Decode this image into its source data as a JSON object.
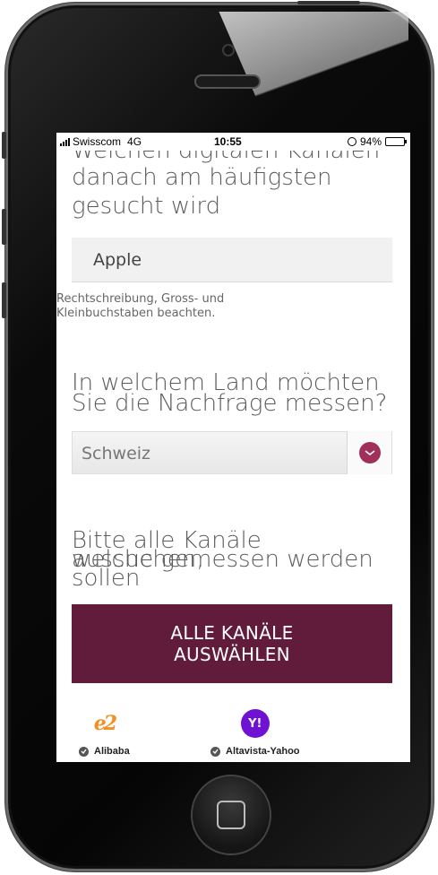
{
  "status_bar": {
    "carrier": "Swisscom",
    "network": "4G",
    "time": "10:55",
    "battery": "94%",
    "battery_level": 0.94
  },
  "form": {
    "scrolled_heading_partial": "Welchen digitalen Kanälen",
    "keyword_heading_line1": "danach am häufigsten",
    "keyword_heading_line2": "gesucht wird",
    "keyword_input_value": "Apple",
    "keyword_hint_line1": "Rechtschreibung, Gross- und",
    "keyword_hint_line2": "Kleinbuchstaben beachten.",
    "country_heading_line1": "In welchem Land möchten",
    "country_heading_line2": "Sie die Nachfrage messen?",
    "country_selected": "Schweiz",
    "channels_heading_line1": "Bitte alle Kanäle aussuchen,",
    "channels_heading_line2": "welche gemessen werden",
    "channels_heading_line3": "sollen",
    "select_all_line1": "ALLE KANÄLE",
    "select_all_line2": "AUSWÄHLEN"
  },
  "channels": [
    {
      "name": "Alibaba",
      "logo_text": "e2",
      "checked": true
    },
    {
      "name": "Altavista-Yahoo",
      "logo_text": "Y!",
      "checked": true
    }
  ],
  "colors": {
    "accent": "#611c3c",
    "dropdown_icon": "#a0305a",
    "alibaba": "#f19024",
    "yahoo": "#6f12d3"
  }
}
